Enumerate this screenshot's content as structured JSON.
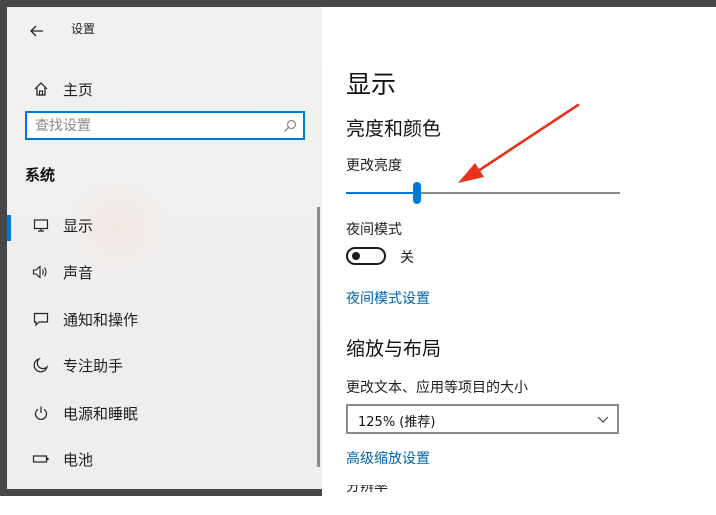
{
  "window": {
    "title": "设置",
    "back_icon": "back-arrow-icon"
  },
  "sidebar": {
    "home": {
      "label": "主页",
      "icon": "home-icon"
    },
    "search": {
      "placeholder": "查找设置",
      "value": "",
      "icon": "search-icon"
    },
    "section_title": "系统",
    "items": [
      {
        "label": "显示",
        "icon": "monitor-icon",
        "selected": true
      },
      {
        "label": "声音",
        "icon": "speaker-icon",
        "selected": false
      },
      {
        "label": "通知和操作",
        "icon": "notification-icon",
        "selected": false
      },
      {
        "label": "专注助手",
        "icon": "moon-icon",
        "selected": false
      },
      {
        "label": "电源和睡眠",
        "icon": "power-icon",
        "selected": false
      },
      {
        "label": "电池",
        "icon": "battery-icon",
        "selected": false
      }
    ]
  },
  "main": {
    "page_title": "显示",
    "brightness": {
      "heading": "亮度和颜色",
      "slider_label": "更改亮度",
      "value_percent": 26
    },
    "night_light": {
      "label": "夜间模式",
      "state": "关",
      "enabled": false,
      "settings_link": "夜间模式设置"
    },
    "scale": {
      "heading": "缩放与布局",
      "label": "更改文本、应用等项目的大小",
      "selected": "125% (推荐)",
      "advanced_link": "高级缩放设置",
      "next_label": "分辨率"
    }
  },
  "colors": {
    "accent": "#0078d7",
    "link": "#0063b1",
    "annotation": "#e8321e",
    "sidebar_bg": "#f0efee",
    "frame": "#474747"
  }
}
